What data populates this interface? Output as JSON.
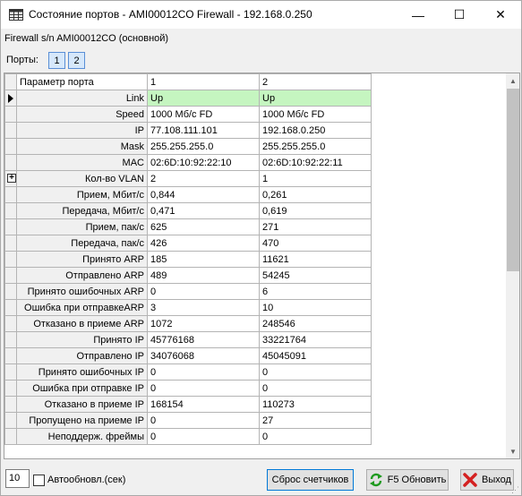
{
  "window": {
    "title": "Состояние портов - AMI00012CO Firewall - 192.168.0.250",
    "minimize_glyph": "—",
    "maximize_glyph": "☐",
    "close_glyph": "✕"
  },
  "device_label": "Firewall s/n AMI00012CO (основной)",
  "ports": {
    "label": "Порты:",
    "buttons": [
      "1",
      "2"
    ]
  },
  "grid": {
    "headers": [
      "Параметр порта",
      "1",
      "2"
    ],
    "rows": [
      {
        "param": "Link",
        "v1": "Up",
        "v2": "Up"
      },
      {
        "param": "Speed",
        "v1": "1000 Мб/с FD",
        "v2": "1000 Мб/с FD"
      },
      {
        "param": "IP",
        "v1": "77.108.111.101",
        "v2": "192.168.0.250"
      },
      {
        "param": "Mask",
        "v1": "255.255.255.0",
        "v2": "255.255.255.0"
      },
      {
        "param": "MAC",
        "v1": "02:6D:10:92:22:10",
        "v2": "02:6D:10:92:22:11"
      },
      {
        "param": "Кол-во VLAN",
        "v1": "2",
        "v2": "1"
      },
      {
        "param": "Прием, Мбит/с",
        "v1": "0,844",
        "v2": "0,261"
      },
      {
        "param": "Передача, Мбит/с",
        "v1": "0,471",
        "v2": "0,619"
      },
      {
        "param": "Прием, пак/с",
        "v1": "625",
        "v2": "271"
      },
      {
        "param": "Передача, пак/с",
        "v1": "426",
        "v2": "470"
      },
      {
        "param": "Принято ARP",
        "v1": "185",
        "v2": "11621"
      },
      {
        "param": "Отправлено ARP",
        "v1": "489",
        "v2": "54245"
      },
      {
        "param": "Принято ошибочных ARP",
        "v1": "0",
        "v2": "6"
      },
      {
        "param": "Ошибка при отправкеARP",
        "v1": "3",
        "v2": "10"
      },
      {
        "param": "Отказано в приеме ARP",
        "v1": "1072",
        "v2": "248546"
      },
      {
        "param": "Принято IP",
        "v1": "45776168",
        "v2": "33221764"
      },
      {
        "param": "Отправлено IP",
        "v1": "34076068",
        "v2": "45045091"
      },
      {
        "param": "Принято ошибочных IP",
        "v1": "0",
        "v2": "0"
      },
      {
        "param": "Ошибка при отправке IP",
        "v1": "0",
        "v2": "0"
      },
      {
        "param": "Отказано в приеме IP",
        "v1": "168154",
        "v2": "110273"
      },
      {
        "param": "Пропущено на приеме IP",
        "v1": "0",
        "v2": "27"
      },
      {
        "param": "Неподдерж. фреймы",
        "v1": "0",
        "v2": "0"
      }
    ],
    "selected_row": 0,
    "expandable_row": 5,
    "link_up_color": "#c5f5c0"
  },
  "bottom": {
    "interval_value": "10",
    "auto_label": "Автообновл.(сек)",
    "reset_label": "Сброс счетчиков",
    "refresh_label": "F5 Обновить",
    "exit_label": "Выход"
  },
  "icons": {
    "app": "grid-window-icon",
    "refresh": "refresh-arrows-icon",
    "exit": "red-x-icon",
    "selected_row": "row-pointer-icon",
    "expand": "expand-plus-icon"
  }
}
